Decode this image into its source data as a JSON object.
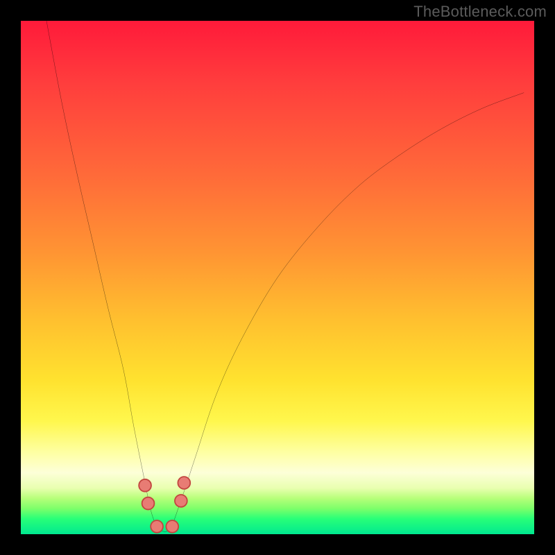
{
  "watermark": {
    "text": "TheBottleneck.com"
  },
  "chart_data": {
    "type": "line",
    "title": "",
    "xlabel": "",
    "ylabel": "",
    "xlim": [
      0,
      100
    ],
    "ylim": [
      0,
      100
    ],
    "background_gradient": [
      "#ff1a3a",
      "#ff9433",
      "#fff74d",
      "#00e890"
    ],
    "series": [
      {
        "name": "bottleneck-curve",
        "x": [
          5,
          8,
          11,
          14,
          17,
          20,
          22,
          24,
          25.5,
          27,
          29,
          31,
          34,
          38,
          43,
          50,
          58,
          66,
          74,
          82,
          90,
          98
        ],
        "values": [
          100,
          84,
          70,
          57,
          44,
          32,
          21,
          11,
          4,
          1,
          1,
          6,
          15,
          27,
          38,
          50,
          60,
          68,
          74,
          79,
          83,
          86
        ]
      }
    ],
    "markers": [
      {
        "name": "left-valley-top",
        "x": 24.2,
        "y": 9.5
      },
      {
        "name": "left-valley-bottom",
        "x": 24.8,
        "y": 6.0
      },
      {
        "name": "floor-left",
        "x": 26.5,
        "y": 1.5
      },
      {
        "name": "floor-right",
        "x": 29.5,
        "y": 1.5
      },
      {
        "name": "right-valley-bottom",
        "x": 31.2,
        "y": 6.5
      },
      {
        "name": "right-valley-top",
        "x": 31.8,
        "y": 10.0
      }
    ],
    "marker_style": {
      "fill": "#e87c74",
      "stroke": "#c24640",
      "r_pct": 1.2
    }
  }
}
